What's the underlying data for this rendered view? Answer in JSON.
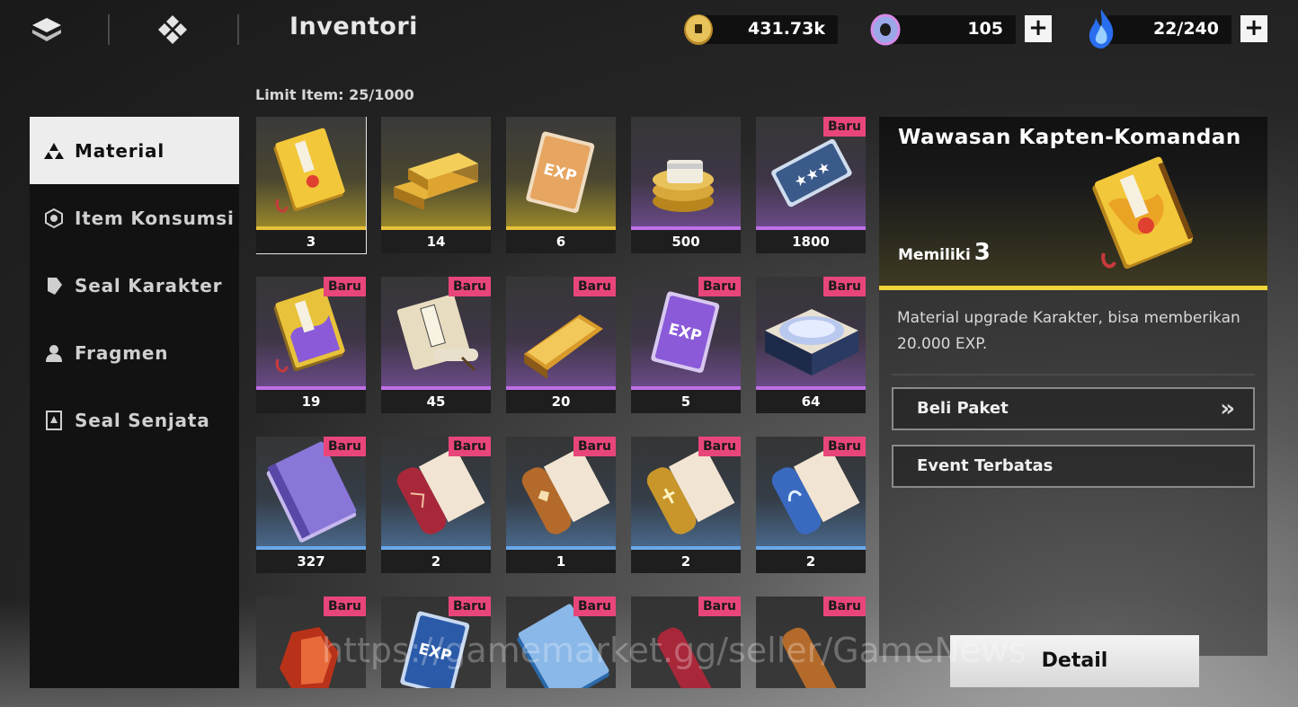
{
  "header": {
    "title": "Inventori",
    "currencies": [
      {
        "icon": "gold-coin-icon",
        "value": "431.73k"
      },
      {
        "icon": "purple-ring-icon",
        "value": "105"
      },
      {
        "icon": "blue-flame-icon",
        "value": "22/240"
      }
    ],
    "plus_label": "+"
  },
  "sidebar": {
    "items": [
      {
        "label": "Material",
        "icon": "material-icon",
        "active": true
      },
      {
        "label": "Item Konsumsi",
        "icon": "consumable-icon",
        "active": false
      },
      {
        "label": "Seal Karakter",
        "icon": "seal-character-icon",
        "active": false
      },
      {
        "label": "Fragmen",
        "icon": "fragment-icon",
        "active": false
      },
      {
        "label": "Seal Senjata",
        "icon": "seal-weapon-icon",
        "active": false
      }
    ]
  },
  "grid": {
    "limit_label": "Limit Item:",
    "limit_value": "25/1000",
    "badge_label": "Baru",
    "items": [
      {
        "count": "3",
        "rarity": "gold",
        "new": false,
        "art": "gold-book",
        "selected": true
      },
      {
        "count": "14",
        "rarity": "gold",
        "new": false,
        "art": "gold-bars"
      },
      {
        "count": "6",
        "rarity": "gold",
        "new": false,
        "art": "exp-card-gold"
      },
      {
        "count": "500",
        "rarity": "purple",
        "new": false,
        "art": "coin-stack"
      },
      {
        "count": "1800",
        "rarity": "purple",
        "new": true,
        "art": "blue-ticket"
      },
      {
        "count": "19",
        "rarity": "purple",
        "new": true,
        "art": "purple-book"
      },
      {
        "count": "45",
        "rarity": "purple",
        "new": true,
        "art": "scroll-book"
      },
      {
        "count": "20",
        "rarity": "purple",
        "new": true,
        "art": "gold-bar"
      },
      {
        "count": "5",
        "rarity": "purple",
        "new": true,
        "art": "exp-card-purple"
      },
      {
        "count": "64",
        "rarity": "purple",
        "new": true,
        "art": "crystal-box"
      },
      {
        "count": "327",
        "rarity": "blue",
        "new": true,
        "art": "purple-notebook"
      },
      {
        "count": "2",
        "rarity": "blue",
        "new": true,
        "art": "red-scroll"
      },
      {
        "count": "1",
        "rarity": "blue",
        "new": true,
        "art": "orange-scroll"
      },
      {
        "count": "2",
        "rarity": "blue",
        "new": true,
        "art": "yellow-scroll"
      },
      {
        "count": "2",
        "rarity": "blue",
        "new": true,
        "art": "blue-scroll"
      },
      {
        "count": "",
        "rarity": "none",
        "new": true,
        "art": "red-crystal"
      },
      {
        "count": "",
        "rarity": "none",
        "new": true,
        "art": "exp-card-blue"
      },
      {
        "count": "",
        "rarity": "none",
        "new": true,
        "art": "blue-notebook"
      },
      {
        "count": "",
        "rarity": "none",
        "new": true,
        "art": "red-scroll-2"
      },
      {
        "count": "",
        "rarity": "none",
        "new": true,
        "art": "orange-scroll-2"
      }
    ]
  },
  "detail": {
    "title": "Wawasan Kapten-Komandan",
    "own_label": "Memiliki",
    "own_value": "3",
    "description": "Material upgrade Karakter, bisa memberikan 20.000 EXP.",
    "buttons": [
      {
        "label": "Beli Paket",
        "chevron": "»"
      },
      {
        "label": "Event Terbatas"
      }
    ],
    "detail_button": "Detail"
  },
  "watermark": "https://gamemarket.gg/seller/GameNews"
}
